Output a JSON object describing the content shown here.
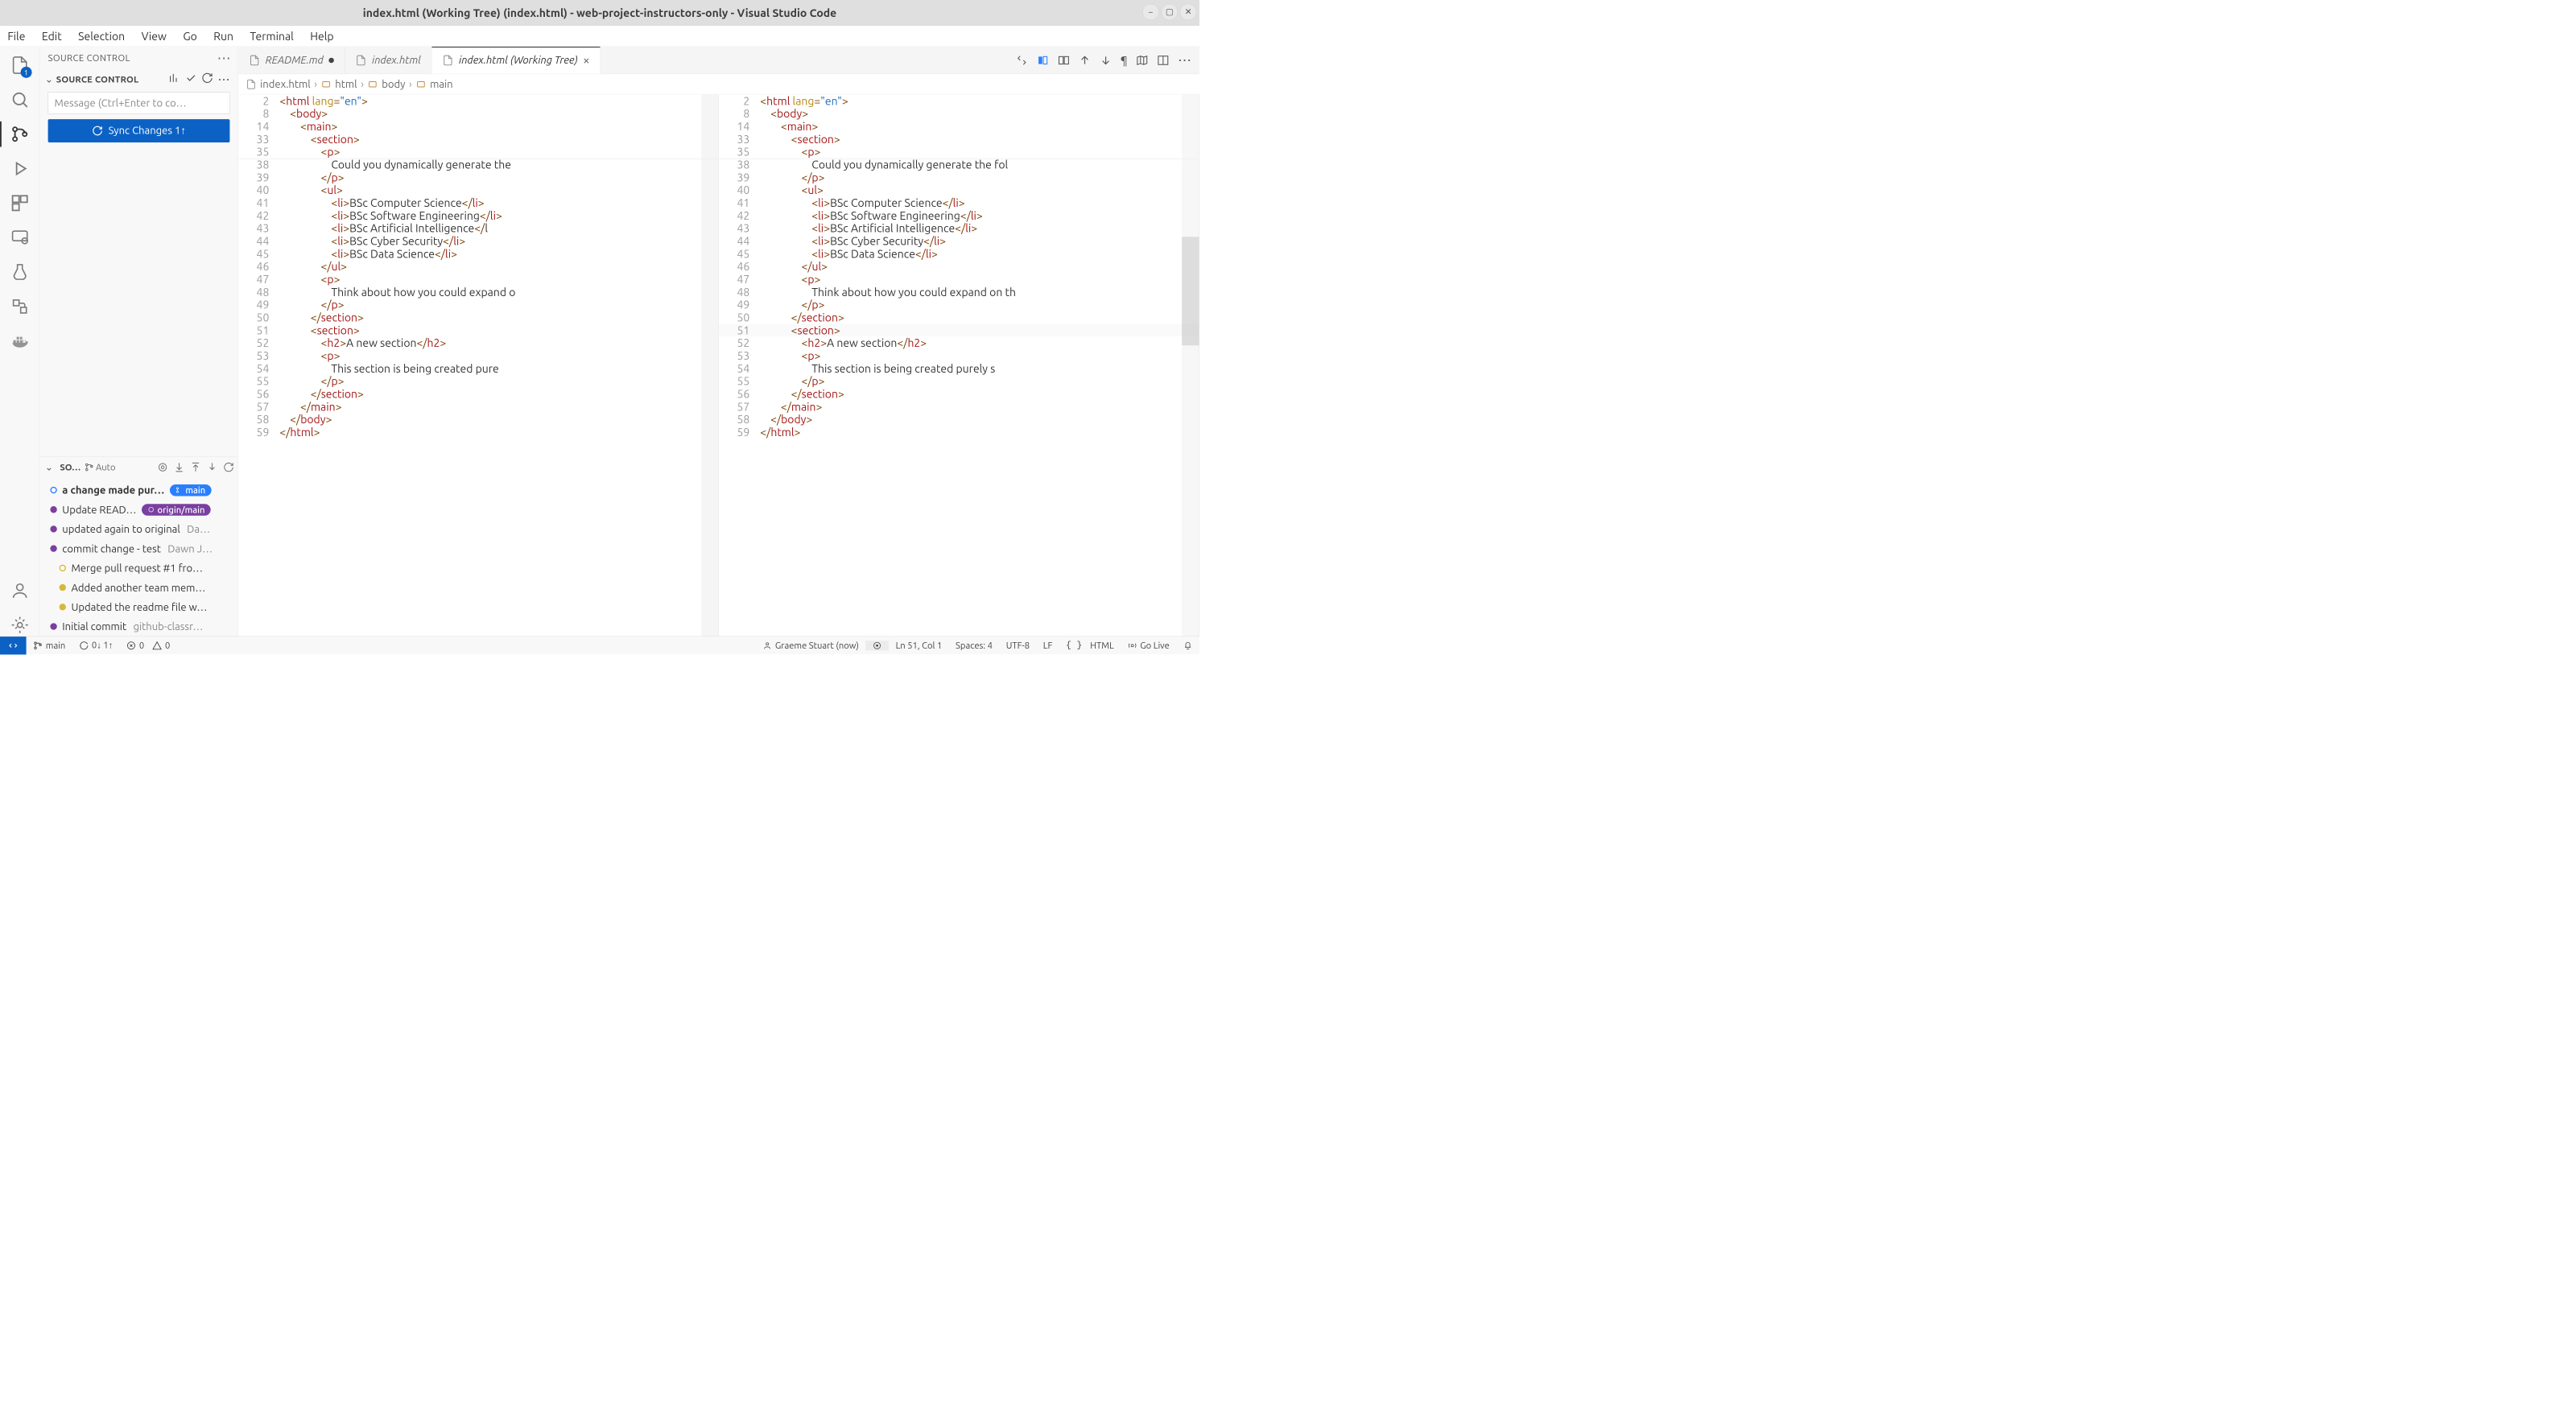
{
  "window": {
    "title": "index.html (Working Tree) (index.html) - web-project-instructors-only - Visual Studio Code"
  },
  "menu": [
    "File",
    "Edit",
    "Selection",
    "View",
    "Go",
    "Run",
    "Terminal",
    "Help"
  ],
  "activity": {
    "explorer_badge": "1"
  },
  "source_control": {
    "header": "SOURCE CONTROL",
    "repo_label": "SOURCE CONTROL",
    "message_placeholder": "Message (Ctrl+Enter to co…",
    "sync_label": "Sync Changes 1↑"
  },
  "graph": {
    "header": "SO…",
    "auto_label": "Auto",
    "commits": [
      {
        "msg": "a change made pur…",
        "badge": "main",
        "badge_class": "pill-blue",
        "bullet": "cb-open",
        "bold": true
      },
      {
        "msg": "Update READ…",
        "badge": "origin/main",
        "badge_class": "pill-purple",
        "bullet": "cb-purple"
      },
      {
        "msg": "updated again to original",
        "author": "Da…",
        "bullet": "cb-purple"
      },
      {
        "msg": "commit change - test",
        "author": "Dawn J…",
        "bullet": "cb-purple"
      },
      {
        "msg": "Merge pull request #1 fro…",
        "bullet": "cb-yellow-open",
        "indent": true
      },
      {
        "msg": "Added another team mem…",
        "bullet": "cb-yellow",
        "indent": true
      },
      {
        "msg": "Updated the readme file w…",
        "bullet": "cb-yellow",
        "indent": true
      },
      {
        "msg": "Initial commit",
        "author": "github-classr…",
        "bullet": "cb-purple"
      }
    ]
  },
  "tabs": [
    {
      "label": "README.md",
      "modified": true
    },
    {
      "label": "index.html"
    },
    {
      "label": "index.html (Working Tree)",
      "active": true,
      "closable": true
    }
  ],
  "breadcrumb": [
    "index.html",
    "html",
    "body",
    "main"
  ],
  "code": {
    "sticky": [
      {
        "n": 2,
        "tokens": [
          [
            "<",
            "pn"
          ],
          [
            "html ",
            "tg"
          ],
          [
            "lang",
            "an"
          ],
          [
            "=",
            "pn"
          ],
          [
            "\"en\"",
            "av"
          ],
          [
            ">",
            "pn"
          ]
        ]
      },
      {
        "n": 8,
        "indent": 1,
        "tokens": [
          [
            "<",
            "pn"
          ],
          [
            "body",
            "tg"
          ],
          [
            ">",
            "pn"
          ]
        ]
      },
      {
        "n": 14,
        "indent": 2,
        "tokens": [
          [
            "<",
            "pn"
          ],
          [
            "main",
            "tg"
          ],
          [
            ">",
            "pn"
          ]
        ]
      },
      {
        "n": 33,
        "indent": 3,
        "tokens": [
          [
            "<",
            "pn"
          ],
          [
            "section",
            "tg"
          ],
          [
            ">",
            "pn"
          ]
        ]
      },
      {
        "n": 35,
        "indent": 4,
        "tokens": [
          [
            "<",
            "pn"
          ],
          [
            "p",
            "tg"
          ],
          [
            ">",
            "pn"
          ]
        ]
      }
    ],
    "left_overflow": "om",
    "right_overflow": "et",
    "lines": [
      {
        "n": 38,
        "indent": 5,
        "tokens": [
          [
            "Could you dynamically generate the",
            ""
          ]
        ],
        "left_trunc": true,
        "right_txt": "Could you dynamically generate the fol"
      },
      {
        "n": 39,
        "indent": 4,
        "tokens": [
          [
            "</",
            "pn"
          ],
          [
            "p",
            "tg"
          ],
          [
            ">",
            "pn"
          ]
        ]
      },
      {
        "n": 40,
        "indent": 4,
        "tokens": [
          [
            "<",
            "pn"
          ],
          [
            "ul",
            "tg"
          ],
          [
            ">",
            "pn"
          ]
        ]
      },
      {
        "n": 41,
        "indent": 5,
        "tokens": [
          [
            "<",
            "pn"
          ],
          [
            "li",
            "tg"
          ],
          [
            ">",
            "pn"
          ],
          [
            "BSc Computer Science",
            ""
          ],
          [
            "</",
            "pn"
          ],
          [
            "li",
            "tg"
          ],
          [
            ">",
            "pn"
          ]
        ]
      },
      {
        "n": 42,
        "indent": 5,
        "tokens": [
          [
            "<",
            "pn"
          ],
          [
            "li",
            "tg"
          ],
          [
            ">",
            "pn"
          ],
          [
            "BSc Software Engineering",
            ""
          ],
          [
            "</",
            "pn"
          ],
          [
            "li",
            "tg"
          ],
          [
            ">",
            "pn"
          ]
        ]
      },
      {
        "n": 43,
        "indent": 5,
        "tokens": [
          [
            "<",
            "pn"
          ],
          [
            "li",
            "tg"
          ],
          [
            ">",
            "pn"
          ],
          [
            "BSc Artificial Intelligence",
            ""
          ],
          [
            "</",
            "pn"
          ],
          [
            "l",
            ""
          ]
        ],
        "left_trunc": true,
        "right_full": [
          [
            "<",
            "pn"
          ],
          [
            "li",
            "tg"
          ],
          [
            ">",
            "pn"
          ],
          [
            "BSc Artificial Intelligence",
            ""
          ],
          [
            "</",
            "pn"
          ],
          [
            "li",
            "tg"
          ],
          [
            ">",
            "pn"
          ]
        ]
      },
      {
        "n": 44,
        "indent": 5,
        "tokens": [
          [
            "<",
            "pn"
          ],
          [
            "li",
            "tg"
          ],
          [
            ">",
            "pn"
          ],
          [
            "BSc Cyber Security",
            ""
          ],
          [
            "</",
            "pn"
          ],
          [
            "li",
            "tg"
          ],
          [
            ">",
            "pn"
          ]
        ]
      },
      {
        "n": 45,
        "indent": 5,
        "tokens": [
          [
            "<",
            "pn"
          ],
          [
            "li",
            "tg"
          ],
          [
            ">",
            "pn"
          ],
          [
            "BSc Data Science",
            ""
          ],
          [
            "</",
            "pn"
          ],
          [
            "li",
            "tg"
          ],
          [
            ">",
            "pn"
          ]
        ]
      },
      {
        "n": 46,
        "indent": 4,
        "tokens": [
          [
            "</",
            "pn"
          ],
          [
            "ul",
            "tg"
          ],
          [
            ">",
            "pn"
          ]
        ]
      },
      {
        "n": 47,
        "indent": 4,
        "tokens": [
          [
            "<",
            "pn"
          ],
          [
            "p",
            "tg"
          ],
          [
            ">",
            "pn"
          ]
        ]
      },
      {
        "n": 48,
        "indent": 5,
        "tokens": [
          [
            "Think about how you could expand o",
            ""
          ]
        ],
        "left_trunc": true,
        "right_txt": "Think about how you could expand on th"
      },
      {
        "n": 49,
        "indent": 4,
        "tokens": [
          [
            "</",
            "pn"
          ],
          [
            "p",
            "tg"
          ],
          [
            ">",
            "pn"
          ]
        ]
      },
      {
        "n": 50,
        "indent": 3,
        "tokens": [
          [
            "</",
            "pn"
          ],
          [
            "section",
            "tg"
          ],
          [
            ">",
            "pn"
          ]
        ]
      },
      {
        "n": 51,
        "indent": 3,
        "tokens": [
          [
            "<",
            "pn"
          ],
          [
            "section",
            "tg"
          ],
          [
            ">",
            "pn"
          ]
        ],
        "hl_right": true
      },
      {
        "n": 52,
        "indent": 4,
        "tokens": [
          [
            "<",
            "pn"
          ],
          [
            "h2",
            "tg"
          ],
          [
            ">",
            "pn"
          ],
          [
            "A new section",
            ""
          ],
          [
            "</",
            "pn"
          ],
          [
            "h2",
            "tg"
          ],
          [
            ">",
            "pn"
          ]
        ]
      },
      {
        "n": 53,
        "indent": 4,
        "tokens": [
          [
            "<",
            "pn"
          ],
          [
            "p",
            "tg"
          ],
          [
            ">",
            "pn"
          ]
        ]
      },
      {
        "n": 54,
        "indent": 5,
        "tokens": [
          [
            "This section is being created pure",
            ""
          ]
        ],
        "left_trunc": true,
        "right_txt": "This section is being created purely s"
      },
      {
        "n": 55,
        "indent": 4,
        "tokens": [
          [
            "</",
            "pn"
          ],
          [
            "p",
            "tg"
          ],
          [
            ">",
            "pn"
          ]
        ]
      },
      {
        "n": 56,
        "indent": 3,
        "tokens": [
          [
            "</",
            "pn"
          ],
          [
            "section",
            "tg"
          ],
          [
            ">",
            "pn"
          ]
        ]
      },
      {
        "n": 57,
        "indent": 2,
        "tokens": [
          [
            "</",
            "pn"
          ],
          [
            "main",
            "tg"
          ],
          [
            ">",
            "pn"
          ]
        ]
      },
      {
        "n": 58,
        "indent": 1,
        "tokens": [
          [
            "</",
            "pn"
          ],
          [
            "body",
            "tg"
          ],
          [
            ">",
            "pn"
          ]
        ]
      },
      {
        "n": 59,
        "indent": 0,
        "tokens": [
          [
            "</",
            "pn"
          ],
          [
            "html",
            "tg"
          ],
          [
            ">",
            "pn"
          ]
        ]
      }
    ]
  },
  "status": {
    "branch": "main",
    "sync": "0↓ 1↑",
    "errors": "0",
    "warnings": "0",
    "author": "Graeme Stuart (now)",
    "cursor": "Ln 51, Col 1",
    "spaces": "Spaces: 4",
    "encoding": "UTF-8",
    "eol": "LF",
    "lang": "HTML",
    "golive": "Go Live"
  }
}
